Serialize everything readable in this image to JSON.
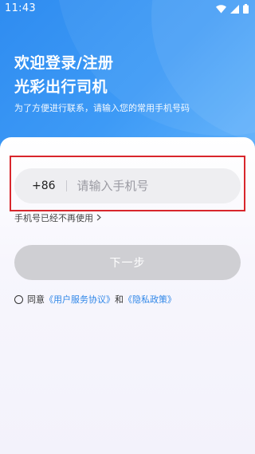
{
  "status_bar": {
    "time": "11:43"
  },
  "header": {
    "title_line1": "欢迎登录/注册",
    "title_line2": "光彩出行司机",
    "subtitle": "为了方便进行联系，请输入您的常用手机号码"
  },
  "form": {
    "country_code": "+86",
    "phone_placeholder": "请输入手机号",
    "phone_value": "",
    "no_longer_used": "手机号已经不再使用",
    "next_button": "下一步"
  },
  "agreement": {
    "prefix": "同意",
    "user_agreement": "《用户服务协议》",
    "conjunction": "和",
    "privacy_policy": "《隐私政策》",
    "checked": false
  },
  "colors": {
    "header_blue": "#3d9af6",
    "link_blue": "#2f87e8",
    "button_disabled": "#cfcfd3",
    "highlight_red": "#d8262c"
  }
}
